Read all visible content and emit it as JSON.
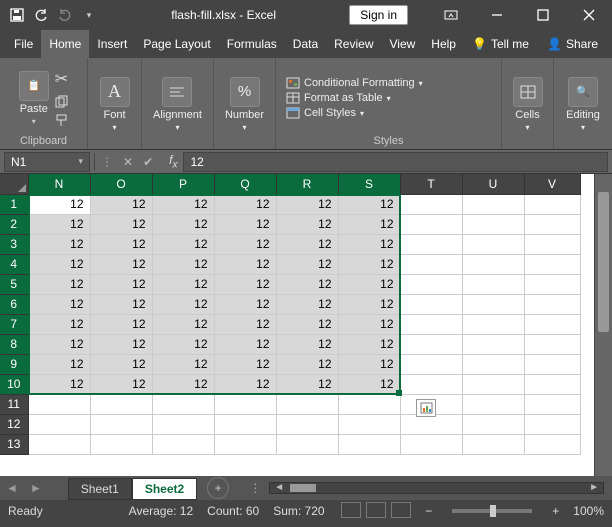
{
  "title": "flash-fill.xlsx  -  Excel",
  "signin": "Sign in",
  "menu": {
    "file": "File",
    "home": "Home",
    "insert": "Insert",
    "pagelayout": "Page Layout",
    "formulas": "Formulas",
    "data": "Data",
    "review": "Review",
    "view": "View",
    "help": "Help",
    "tellme": "Tell me",
    "share": "Share"
  },
  "ribbon": {
    "clipboard": {
      "paste": "Paste",
      "label": "Clipboard"
    },
    "font": {
      "btn": "Font"
    },
    "alignment": {
      "btn": "Alignment"
    },
    "number": {
      "btn": "Number"
    },
    "styles": {
      "cond": "Conditional Formatting",
      "table": "Format as Table",
      "cellstyles": "Cell Styles",
      "label": "Styles"
    },
    "cells": {
      "btn": "Cells"
    },
    "editing": {
      "btn": "Editing"
    }
  },
  "nameBox": "N1",
  "formula": "12",
  "columns": [
    "N",
    "O",
    "P",
    "Q",
    "R",
    "S",
    "T",
    "U",
    "V"
  ],
  "rows": [
    "1",
    "2",
    "3",
    "4",
    "5",
    "6",
    "7",
    "8",
    "9",
    "10",
    "11",
    "12",
    "13"
  ],
  "selCols": 6,
  "selRows": 10,
  "cellValue": "12",
  "sheets": {
    "s1": "Sheet1",
    "s2": "Sheet2"
  },
  "status": {
    "ready": "Ready",
    "avg": "Average: 12",
    "count": "Count: 60",
    "sum": "Sum: 720",
    "zoom": "100%"
  }
}
